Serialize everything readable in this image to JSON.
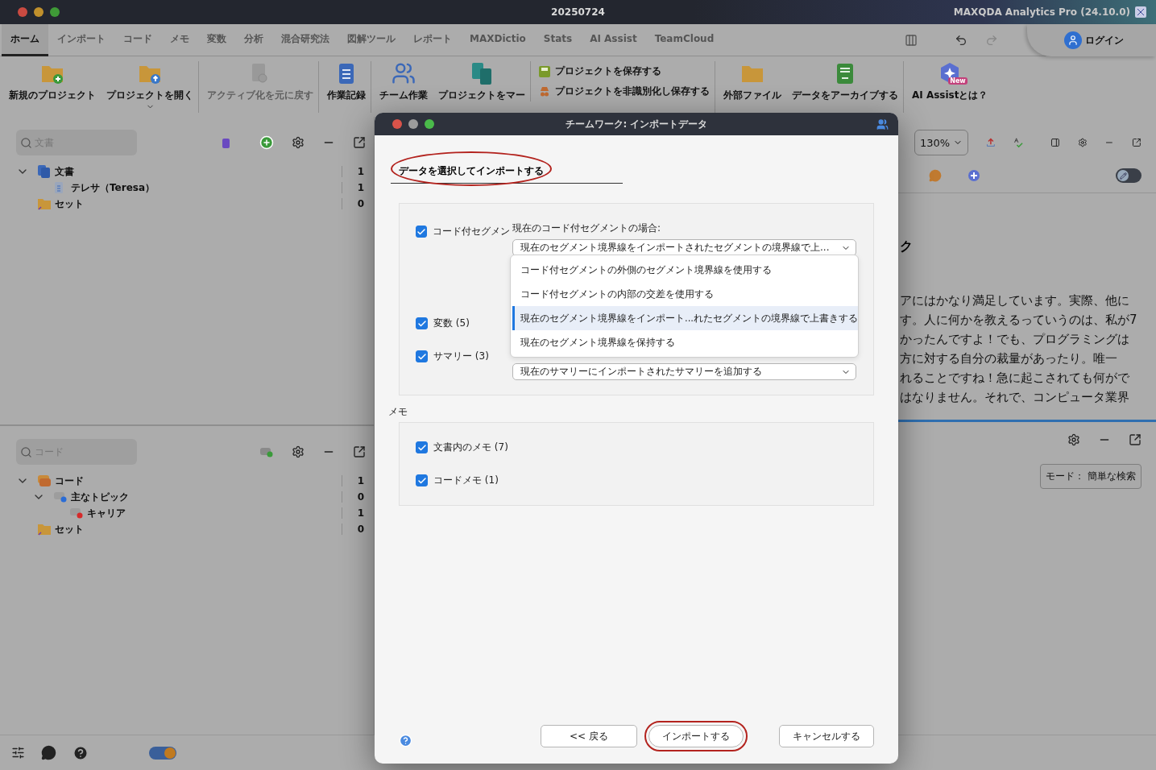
{
  "window": {
    "title": "20250724",
    "app_name": "MAXQDA Analytics Pro (24.10.0)"
  },
  "menu_tabs": [
    {
      "label": "ホーム",
      "selected": true
    },
    {
      "label": "インポート",
      "selected": false
    },
    {
      "label": "コード",
      "selected": false
    },
    {
      "label": "メモ",
      "selected": false
    },
    {
      "label": "変数",
      "selected": false
    },
    {
      "label": "分析",
      "selected": false
    },
    {
      "label": "混合研究法",
      "selected": false
    },
    {
      "label": "図解ツール",
      "selected": false
    },
    {
      "label": "レポート",
      "selected": false
    },
    {
      "label": "MAXDictio",
      "selected": false
    },
    {
      "label": "Stats",
      "selected": false
    },
    {
      "label": "AI Assist",
      "selected": false
    },
    {
      "label": "TeamCloud",
      "selected": false
    }
  ],
  "login": {
    "label": "ログイン"
  },
  "ribbon": [
    {
      "kind": "large",
      "label": "新規のプロジェクト",
      "disabled": false,
      "group_start": false
    },
    {
      "kind": "large",
      "label": "プロジェクトを開く",
      "disabled": false,
      "group_start": false,
      "has_menu": true
    },
    {
      "kind": "large",
      "label": "アクティブ化を元に戻す",
      "disabled": true,
      "group_start": true
    },
    {
      "kind": "large",
      "label": "作業記録",
      "disabled": false,
      "group_start": true
    },
    {
      "kind": "large",
      "label": "チーム作業",
      "disabled": false,
      "group_start": true
    },
    {
      "kind": "large",
      "label": "プロジェクトをマー",
      "disabled": false,
      "group_start": false
    },
    {
      "kind": "stack",
      "group_start": true,
      "items": [
        {
          "label": "プロジェクトを保存する"
        },
        {
          "label": "プロジェクトを非識別化し保存する"
        }
      ]
    },
    {
      "kind": "large",
      "label": "外部ファイル",
      "disabled": false,
      "group_start": true
    },
    {
      "kind": "large",
      "label": "データをアーカイブする",
      "disabled": false,
      "group_start": false
    },
    {
      "kind": "large",
      "label": "AI Assistとは？",
      "disabled": false,
      "group_start": true,
      "badge": "New"
    }
  ],
  "documents_pane": {
    "search_placeholder": "文書",
    "tree": [
      {
        "label": "文書",
        "count": "1",
        "expanded": true,
        "children": [
          {
            "label": "テレサ（Teresa）",
            "count": "1"
          }
        ]
      },
      {
        "label": "セット",
        "count": "0"
      }
    ]
  },
  "codes_pane": {
    "search_placeholder": "コード",
    "tree": [
      {
        "label": "コード",
        "count": "1",
        "expanded": true,
        "children": [
          {
            "label": "主なトピック",
            "count": "0",
            "color": "#2a6cd6",
            "expanded": true,
            "children": [
              {
                "label": "キャリア",
                "count": "1",
                "color": "#d62a2a"
              }
            ]
          }
        ]
      },
      {
        "label": "セット",
        "count": "0"
      }
    ]
  },
  "document_pane": {
    "zoom": "130%",
    "heading": "ク",
    "lines": [
      "アにはかなり満足しています。実際、他に",
      "す。人に何かを教えるっていうのは、私が7",
      "かったんですよ！でも、プログラミングは",
      "方に対する自分の裁量があったり。唯一",
      "れることですね！急に起こされても何がで",
      "はなりません。それで、コンピュータ業界"
    ],
    "mode_button": "モード： 簡単な検索",
    "edit_toggle": {
      "on": false
    }
  },
  "status_bar": {
    "toggle": {
      "on": true
    }
  },
  "dialog": {
    "title": "チームワーク: インポートデータ",
    "heading": {
      "label": "データを選択してインポートする",
      "annotated": true
    },
    "segments": {
      "label": "コード付セグメン",
      "checked": true,
      "caption": "現在のコード付セグメントの場合:",
      "select_value": "現在のセグメント境界線をインポートされたセグメントの境界線で上...",
      "options": [
        {
          "label": "コード付セグメントの外側のセグメント境界線を使用する",
          "selected": false
        },
        {
          "label": "コード付セグメントの内部の交差を使用する",
          "selected": false
        },
        {
          "label": "現在のセグメント境界線をインポート...れたセグメントの境界線で上書きする",
          "selected": true
        },
        {
          "label": "現在のセグメント境界線を保持する",
          "selected": false
        }
      ]
    },
    "variables": {
      "label": "変数 (5)",
      "checked": true
    },
    "summaries": {
      "label": "サマリー (3)",
      "checked": true,
      "select_value": "現在のサマリーにインポートされたサマリーを追加する"
    },
    "memo_section": {
      "title": "メモ",
      "items": [
        {
          "label": "文書内のメモ (7)",
          "checked": true
        },
        {
          "label": "コードメモ (1)",
          "checked": true
        }
      ]
    },
    "buttons": [
      {
        "label": "<< 戻る",
        "annotated": false
      },
      {
        "label": "インポートする",
        "annotated": true
      },
      {
        "label": "キャンセルする",
        "annotated": false
      }
    ]
  }
}
